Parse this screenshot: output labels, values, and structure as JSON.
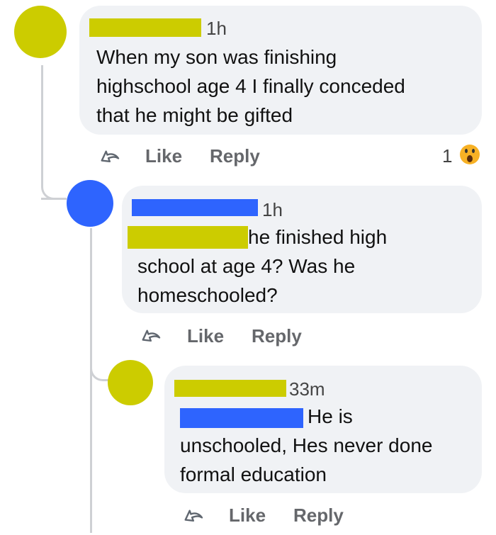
{
  "colors": {
    "bubble": "#f0f2f5",
    "yellow_redaction": "#cccc00",
    "blue_redaction": "#2e64fe",
    "thread_line": "#ced0d4",
    "action_text": "#65676b"
  },
  "comments": [
    {
      "avatar_color": "#cccc00",
      "time": "1h",
      "text_lines": [
        "When my son was finishing",
        "highschool age 4 I finally conceded",
        "that he might be gifted"
      ],
      "actions": {
        "like": "Like",
        "reply": "Reply"
      },
      "reaction_count": "1",
      "reaction_icon": "wow-emoji-icon"
    },
    {
      "avatar_color": "#2e64fe",
      "time": "1h",
      "text_lines": [
        "he finished high",
        "school at age 4? Was he",
        "homeschooled?"
      ],
      "actions": {
        "like": "Like",
        "reply": "Reply"
      }
    },
    {
      "avatar_color": "#cccc00",
      "time": "33m",
      "text_lines": [
        "He is",
        "unschooled, Hes never done",
        "formal education"
      ],
      "actions": {
        "like": "Like",
        "reply": "Reply"
      }
    }
  ]
}
